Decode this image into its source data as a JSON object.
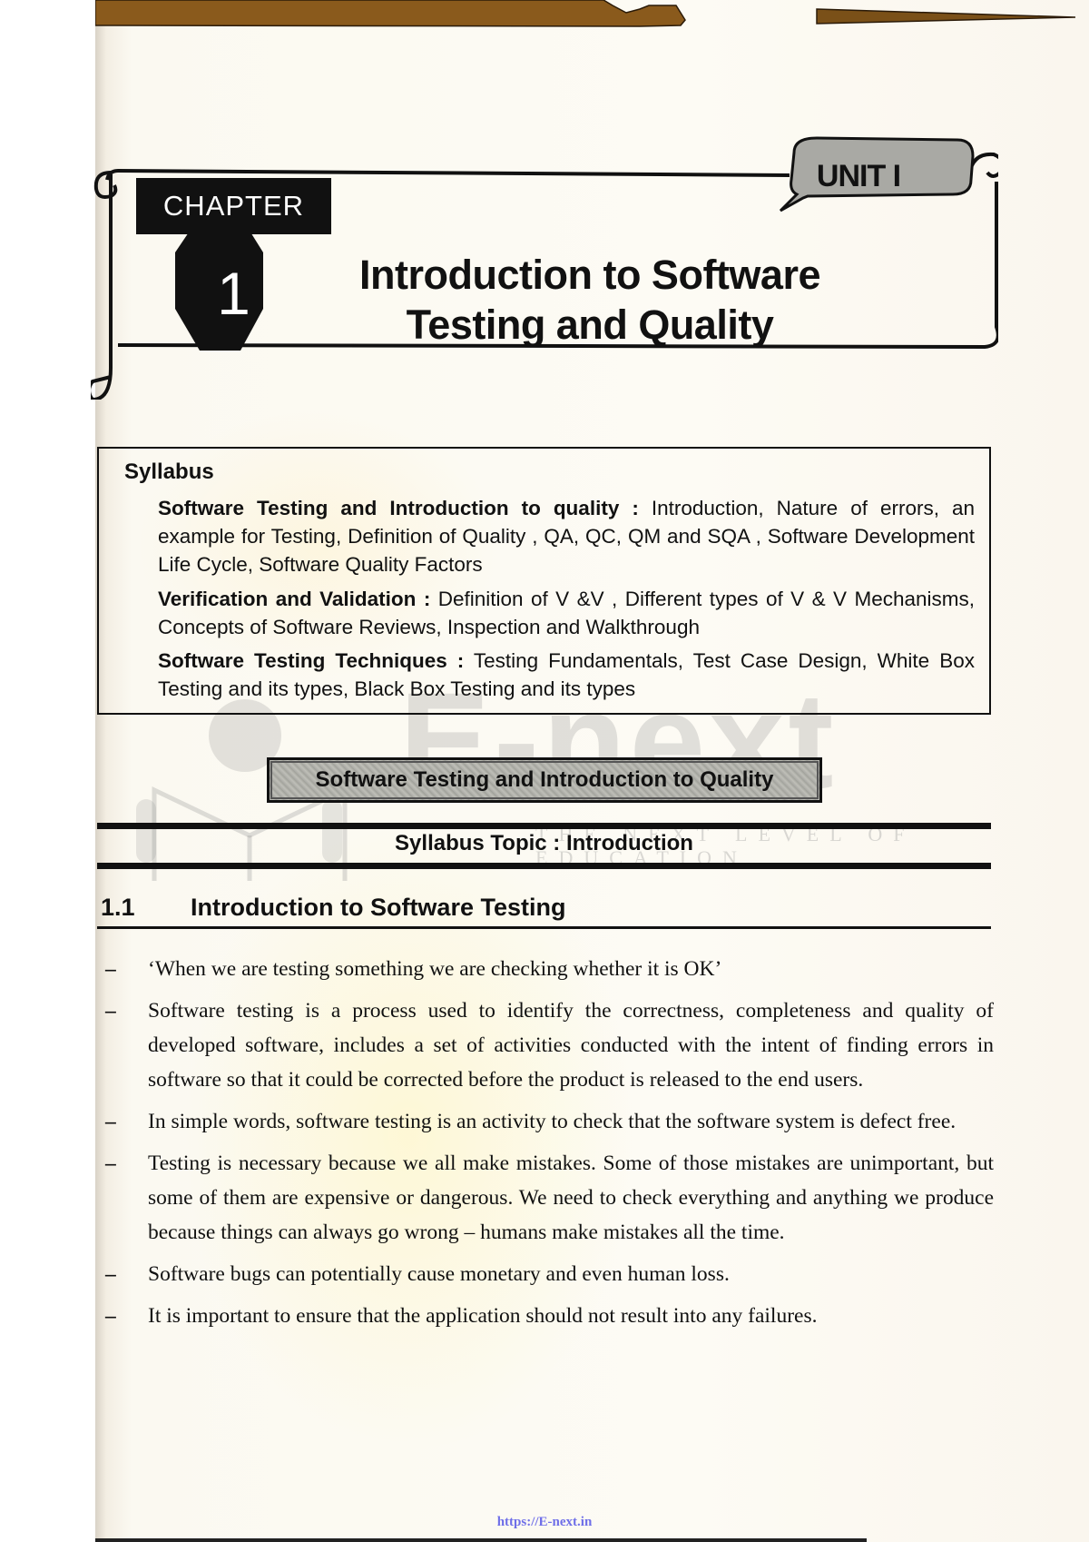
{
  "banner": {
    "chapter_label": "CHAPTER",
    "chapter_number": "1",
    "title_line1": "Introduction to Software",
    "title_line2": "Testing and Quality",
    "unit_label": "UNIT I"
  },
  "syllabus": {
    "heading": "Syllabus",
    "items": [
      {
        "title": "Software Testing and Introduction to quality :",
        "text": " Introduction, Nature of errors, an example for Testing, Definition of Quality , QA, QC, QM and SQA , Software Development Life Cycle, Software Quality Factors"
      },
      {
        "title": "Verification and Validation :",
        "text": " Definition of V &V , Different types of V & V Mechanisms, Concepts of Software Reviews, Inspection and Walkthrough"
      },
      {
        "title": "Software Testing Techniques :",
        "text": " Testing Fundamentals, Test Case Design, White Box Testing and its types, Black Box Testing and its types"
      }
    ]
  },
  "section_title": "Software Testing and Introduction to Quality",
  "syllabus_topic": "Syllabus Topic : Introduction",
  "heading": {
    "number": "1.1",
    "title": "Introduction to Software Testing"
  },
  "bullets": [
    "‘When we are testing something we are checking whether it is OK’",
    "Software testing is a process used to identify the correctness, completeness and quality of developed software, includes a set of activities conducted with the intent of finding errors in software so that it could be corrected before the product is released to the end users.",
    "In simple words, software testing is an activity to check that the software system is defect free.",
    "Testing is necessary because we all make mistakes. Some of those mistakes are unimportant, but some of them are expensive or dangerous. We need to check everything and anything we produce because things can always go wrong – humans make mistakes all the time.",
    "Software bugs can potentially cause monetary and even human loss.",
    "It is important to ensure that the application should not result into any failures."
  ],
  "bullet_marker": "–",
  "watermark": {
    "brand": "E-next",
    "tagline": "THE NEXT LEVEL OF EDUCATION"
  },
  "footer": {
    "link": "https://E-next.in"
  },
  "colors": {
    "ink": "#111111",
    "paper": "#fdfbf4",
    "footer_link": "#6f6fe8",
    "top_strip": "#8a5a1c"
  }
}
